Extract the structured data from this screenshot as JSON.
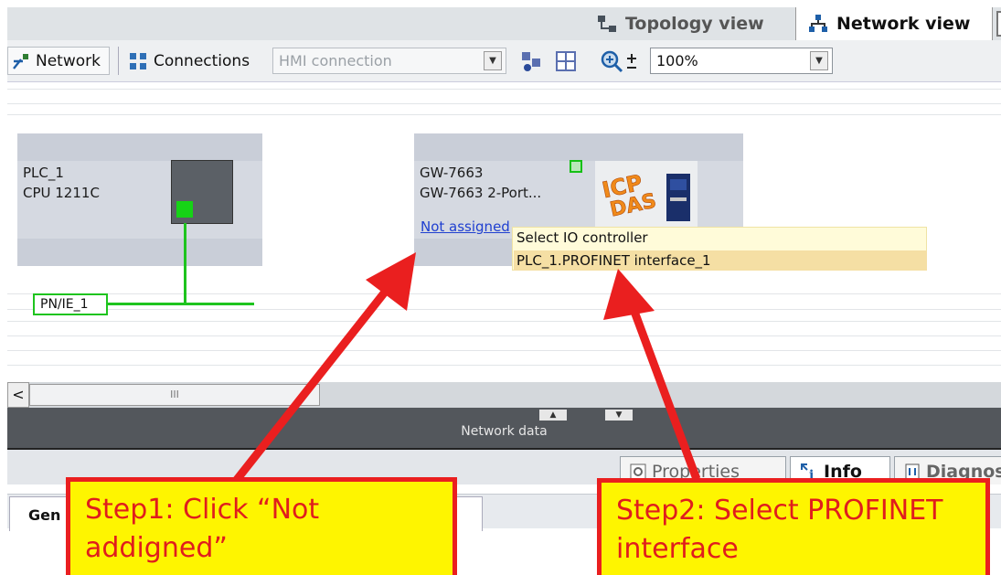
{
  "view_tabs": {
    "topology_label": "Topology view",
    "network_label": "Network view"
  },
  "toolbar": {
    "network_label": "Network",
    "connections_label": "Connections",
    "connection_type": "HMI connection",
    "zoom": "100%"
  },
  "devices": {
    "plc": {
      "name": "PLC_1",
      "type": "CPU 1211C"
    },
    "gateway": {
      "name": "GW-7663",
      "type": "GW-7663  2-Port...",
      "status_link": "Not assigned"
    }
  },
  "subnet": {
    "label": "PN/IE_1"
  },
  "popup": {
    "title": "Select IO controller",
    "items": [
      "PLC_1.PROFINET interface_1"
    ]
  },
  "scrollbar": {
    "thumb_grip": "III",
    "left_arrow": "<"
  },
  "panel": {
    "title": "Network data",
    "collapse_up": "▲",
    "collapse_down": "▼"
  },
  "inspector_tabs": {
    "properties": "Properties",
    "info": "Info",
    "diagnostics": "Diagnos"
  },
  "lower_tab": "Gen",
  "annotations": {
    "step1": "Step1: Click “Not addigned”",
    "step2": "Step2: Select PROFINET interface"
  },
  "colors": {
    "annotation_red": "#ea1f1f",
    "annotation_yellow": "#fef500",
    "subnet_green": "#1ec41e",
    "link_blue": "#1f3fd0"
  }
}
